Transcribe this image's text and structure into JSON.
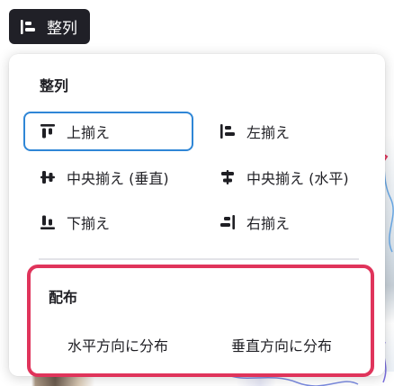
{
  "toolbar": {
    "align_button_label": "整列",
    "align_icon": "align-left-icon"
  },
  "panel": {
    "align_section_title": "整列",
    "align_options": [
      {
        "label": "上揃え",
        "icon": "align-top-icon",
        "selected": true
      },
      {
        "label": "左揃え",
        "icon": "align-left-icon",
        "selected": false
      },
      {
        "label": "中央揃え (垂直)",
        "icon": "align-center-vertical-icon",
        "selected": false
      },
      {
        "label": "中央揃え (水平)",
        "icon": "align-center-horizontal-icon",
        "selected": false
      },
      {
        "label": "下揃え",
        "icon": "align-bottom-icon",
        "selected": false
      },
      {
        "label": "右揃え",
        "icon": "align-right-icon",
        "selected": false
      }
    ],
    "distribute_section_title": "配布",
    "distribute_options": [
      {
        "label": "水平方向に分布"
      },
      {
        "label": "垂直方向に分布"
      }
    ]
  },
  "colors": {
    "toolbar_bg": "#202027",
    "selected_outline": "#2f86d6",
    "highlight_box": "#e0345b",
    "text": "#1f1f24"
  }
}
